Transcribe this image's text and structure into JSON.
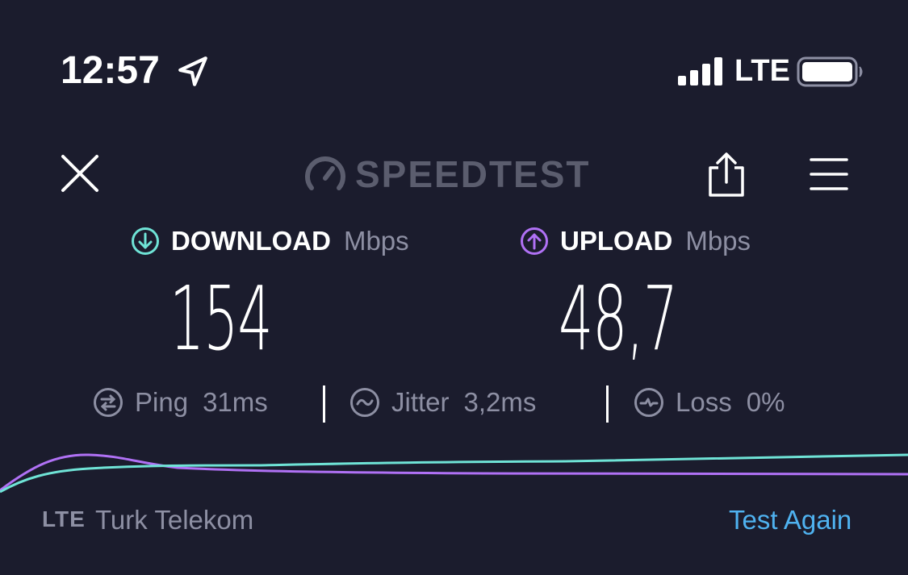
{
  "status_bar": {
    "time": "12:57",
    "carrier": "LTE",
    "location_icon": "location-arrow-icon",
    "signal_icon": "cellular-signal-icon",
    "battery_icon": "battery-icon"
  },
  "header": {
    "brand": "SPEEDTEST",
    "logo_icon": "speedometer-icon",
    "close_icon": "close-icon",
    "share_icon": "share-icon",
    "menu_icon": "hamburger-menu-icon"
  },
  "download": {
    "label": "DOWNLOAD",
    "unit": "Mbps",
    "value": "154",
    "color": "#6fe3d6"
  },
  "upload": {
    "label": "UPLOAD",
    "unit": "Mbps",
    "value": "48,7",
    "color": "#b071f5"
  },
  "stats": {
    "ping": {
      "label": "Ping",
      "value": "31ms"
    },
    "jitter": {
      "label": "Jitter",
      "value": "3,2ms"
    },
    "loss": {
      "label": "Loss",
      "value": "0%"
    }
  },
  "footer": {
    "network_type": "LTE",
    "provider": "Turk Telekom",
    "test_again": "Test Again"
  },
  "colors": {
    "background": "#1b1c2d",
    "muted_text": "#8d8fa3",
    "link": "#4fb2f0"
  }
}
